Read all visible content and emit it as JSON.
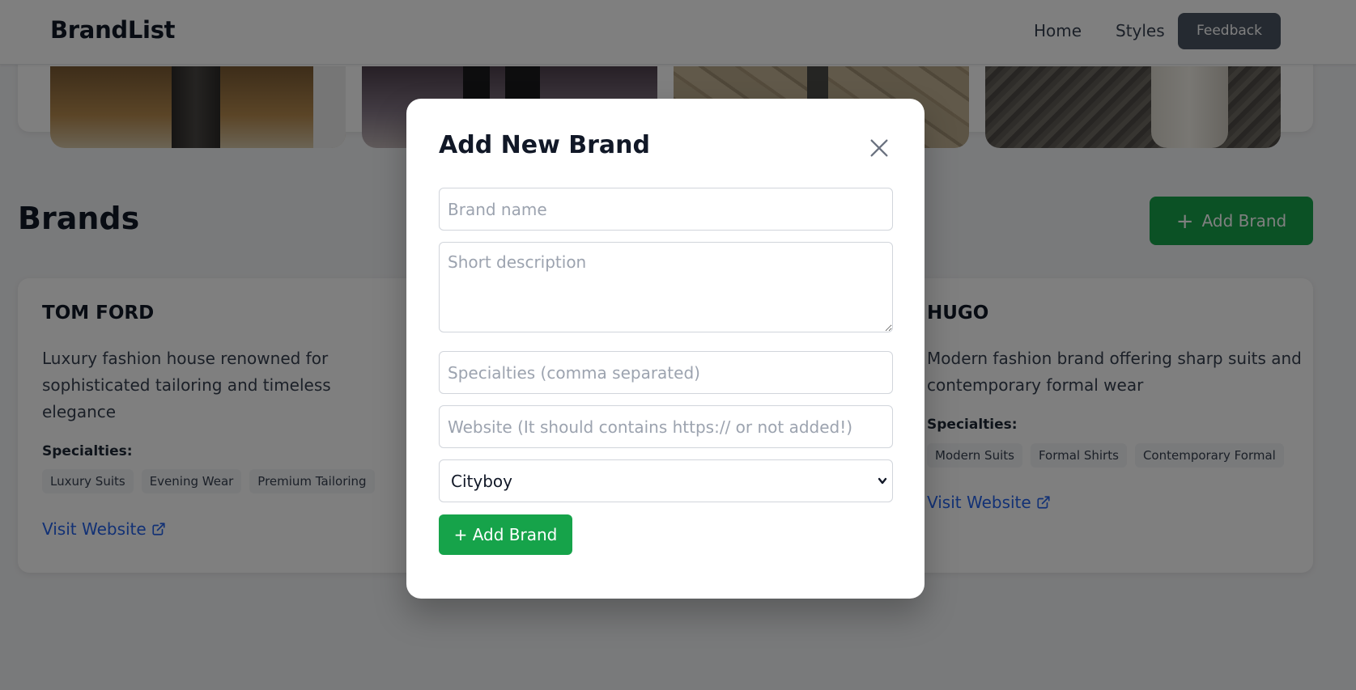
{
  "header": {
    "logo": "BrandList",
    "nav": {
      "home": "Home",
      "styles": "Styles",
      "feedback": "Feedback"
    }
  },
  "brands_section": {
    "title": "Brands",
    "add_button_label": "Add Brand",
    "cards": [
      {
        "name": "TOM FORD",
        "description": "Luxury fashion house renowned for sophisticated tailoring and timeless elegance",
        "specialties_label": "Specialties:",
        "specialties": [
          "Luxury Suits",
          "Evening Wear",
          "Premium Tailoring"
        ],
        "link_label": "Visit Website"
      },
      {
        "name": "HUGO",
        "description": "Modern fashion brand offering sharp suits and contemporary formal wear",
        "specialties_label": "Specialties:",
        "specialties": [
          "Modern Suits",
          "Formal Shirts",
          "Contemporary Formal"
        ],
        "link_label": "Visit Website"
      }
    ]
  },
  "modal": {
    "title": "Add New Brand",
    "fields": {
      "name_placeholder": "Brand name",
      "description_placeholder": "Short description",
      "specialties_placeholder": "Specialties (comma separated)",
      "website_placeholder": "Website (It should contains https:// or not added!)"
    },
    "style_select": {
      "selected": "Cityboy"
    },
    "submit_label": "+ Add Brand"
  },
  "colors": {
    "accent_green": "#16a34a",
    "link_blue": "#2563eb",
    "feedback_gray": "#4b5563"
  }
}
